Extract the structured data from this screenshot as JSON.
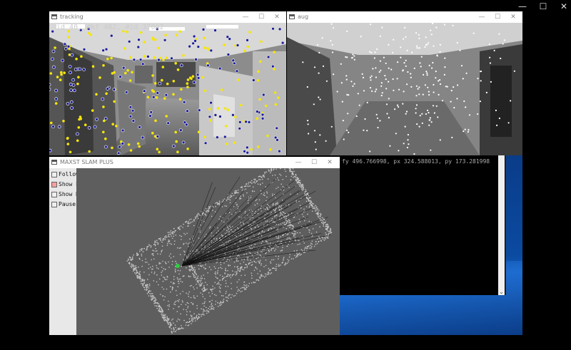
{
  "outer_window": {
    "buttons": [
      "—",
      "☐",
      "✕"
    ]
  },
  "tracking": {
    "title": "tracking",
    "overlay": "id 40, #kf 482, #id 37002"
  },
  "aug": {
    "title": "aug"
  },
  "slam": {
    "title": "MAXST SLAM PLUS",
    "options": [
      {
        "label": "Follow Camera",
        "checked": false
      },
      {
        "label": "Show Points",
        "checked": true
      },
      {
        "label": "Show KeyFrames",
        "checked": false
      },
      {
        "label": "Pause",
        "checked": false
      }
    ]
  },
  "console": {
    "text": "fy 496.766998, px 324.588013, py 173.281998",
    "scroll_arrow": "⌄"
  },
  "colors": {
    "feature_yellow": "#f5e60a",
    "feature_blue": "#1a1a9c",
    "desktop_blue": "#0a4aa0",
    "slam_bg": "#5e5e5e"
  }
}
